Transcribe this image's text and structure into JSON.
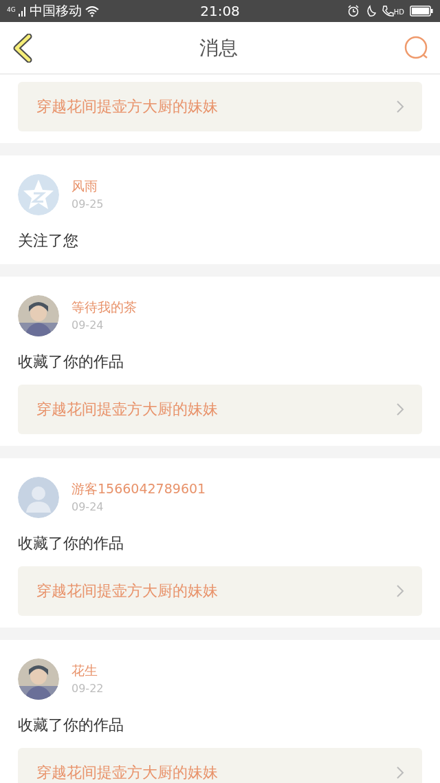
{
  "status_bar": {
    "network": "4G",
    "carrier": "中国移动",
    "time": "21:08",
    "call_badge": "HD"
  },
  "header": {
    "title": "消息"
  },
  "messages": [
    {
      "work_title": "穿越花间提壶方大厨的妹妹"
    },
    {
      "kind": "star",
      "name": "风雨",
      "date": "09-25",
      "action": "关注了您"
    },
    {
      "kind": "picture",
      "name": "等待我的茶",
      "date": "09-24",
      "action": "收藏了你的作品",
      "work_title": "穿越花间提壶方大厨的妹妹"
    },
    {
      "kind": "default",
      "name": "游客1566042789601",
      "date": "09-24",
      "action": "收藏了你的作品",
      "work_title": "穿越花间提壶方大厨的妹妹"
    },
    {
      "kind": "picture",
      "name": "花生",
      "date": "09-22",
      "action": "收藏了你的作品",
      "work_title": "穿越花间提壶方大厨的妹妹"
    }
  ]
}
